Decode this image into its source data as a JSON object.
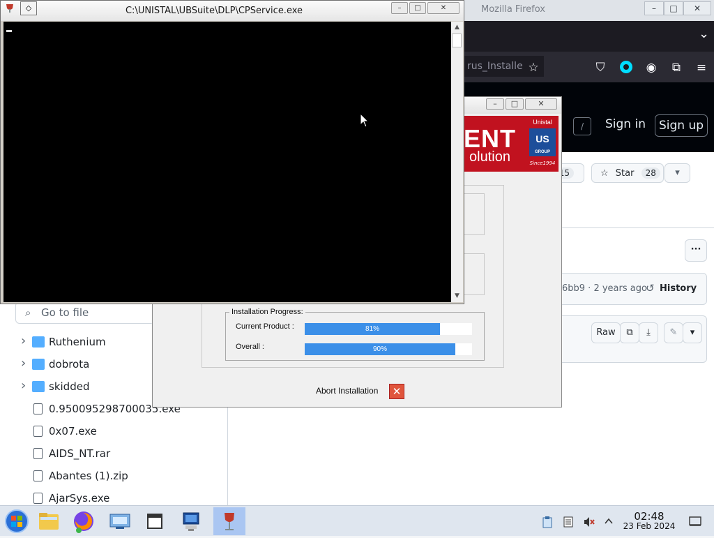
{
  "firefox": {
    "title": "Mozilla Firefox",
    "btn_minimize": "–",
    "btn_maximize": "□",
    "btn_close": "✕",
    "tab_list_glyph": "⌄",
    "url_text": "rus_Installe",
    "star_glyph": "☆",
    "pocket_glyph": "⛉",
    "account_glyph": "◉",
    "extensions_glyph": "⧉",
    "menu_glyph": "≡"
  },
  "github": {
    "search_slash": "/",
    "sign_in": "Sign in",
    "sign_up": "Sign up",
    "fork_count": "15",
    "star_label": "Star",
    "star_count": "28",
    "dropdown_glyph": "▾",
    "more_glyph": "···",
    "commit_info": "6bb9 · 2 years ago",
    "history_label": "History",
    "raw_label": "Raw",
    "go_to_file": "Go to file",
    "files": [
      {
        "name": "Ruthenium",
        "type": "folder"
      },
      {
        "name": "dobrota",
        "type": "folder"
      },
      {
        "name": "skidded",
        "type": "folder"
      },
      {
        "name": "0.950095298700035.exe",
        "type": "file"
      },
      {
        "name": "0x07.exe",
        "type": "file"
      },
      {
        "name": "AIDS_NT.rar",
        "type": "file"
      },
      {
        "name": "Abantes (1).zip",
        "type": "file"
      },
      {
        "name": "AjarSys.exe",
        "type": "file"
      }
    ]
  },
  "installer": {
    "btn_minimize": "–",
    "btn_maximize": "□",
    "btn_close": "✕",
    "banner_big": "ENT",
    "banner_sub": "olution",
    "logo_brand": "Unistal",
    "logo_mark": "US",
    "logo_group": "GROUP",
    "logo_since": "Since1994",
    "progress_legend": "Installation Progress:",
    "current_label": "Current Product :",
    "current_percent": 81,
    "current_text": "81%",
    "overall_label": "Overall :",
    "overall_percent": 90,
    "overall_text": "90%",
    "abort_label": "Abort Installation",
    "abort_glyph": "✕"
  },
  "console": {
    "title": "C:\\UNISTAL\\UBSuite\\DLP\\CPService.exe",
    "sys_glyph": "◇",
    "btn_minimize": "–",
    "btn_maximize": "□",
    "btn_close": "✕",
    "scroll_up": "▲",
    "scroll_down": "▼"
  },
  "taskbar": {
    "time": "02:48",
    "date": "23 Feb 2024"
  },
  "colors": {
    "progress_fill": "#3b8fe8",
    "banner_red": "#c1121f",
    "taskbar_active": "#aac6f2"
  }
}
